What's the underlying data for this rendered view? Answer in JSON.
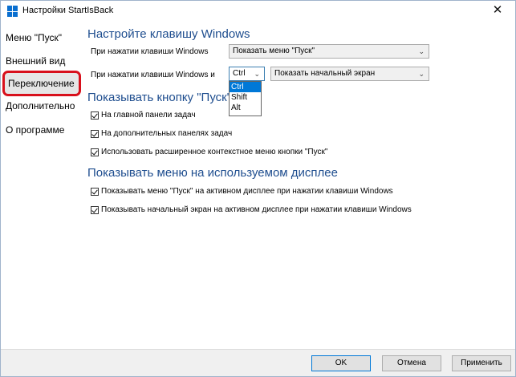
{
  "window": {
    "title": "Настройки StartIsBack",
    "close_symbol": "✕"
  },
  "sidebar": {
    "items": [
      {
        "label": "Меню \"Пуск\""
      },
      {
        "label": "Внешний вид"
      },
      {
        "label": "Переключение"
      },
      {
        "label": "Дополнительно"
      },
      {
        "label": "О программе"
      }
    ],
    "selected_index": 2
  },
  "keys_section": {
    "heading": "Настройте клавишу Windows",
    "row1_label": "При нажатии клавиши Windows",
    "row1_value": "Показать меню \"Пуск\"",
    "row2_label": "При нажатии клавиши Windows и",
    "modifier_value": "Ctrl",
    "modifier_options": [
      "Ctrl",
      "Shift",
      "Alt"
    ],
    "row2_value": "Показать начальный экран"
  },
  "button_section": {
    "heading": "Показывать кнопку \"Пуск\"",
    "options": [
      {
        "label": "На главной панели задач",
        "checked": true
      },
      {
        "label": "На дополнительных панелях задач",
        "checked": true
      },
      {
        "label": "Использовать расширенное контекстное меню кнопки \"Пуск\"",
        "checked": true
      }
    ]
  },
  "display_section": {
    "heading": "Показывать меню на используемом дисплее",
    "options": [
      {
        "label": "Показывать меню \"Пуск\" на активном дисплее при нажатии клавиши Windows",
        "checked": true
      },
      {
        "label": "Показывать начальный экран на активном дисплее при нажатии клавиши Windows",
        "checked": true
      }
    ]
  },
  "footer": {
    "ok_label": "OK",
    "cancel_label": "Отмена",
    "apply_label": "Применить"
  },
  "colors": {
    "heading": "#1f4e8f",
    "selection_outline": "#d8101c",
    "highlight": "#0078d7",
    "app_icon": "#0a6fd0"
  },
  "icons": [
    "app-grid-icon",
    "close-icon",
    "chevron-down-icon",
    "checkmark-icon"
  ]
}
